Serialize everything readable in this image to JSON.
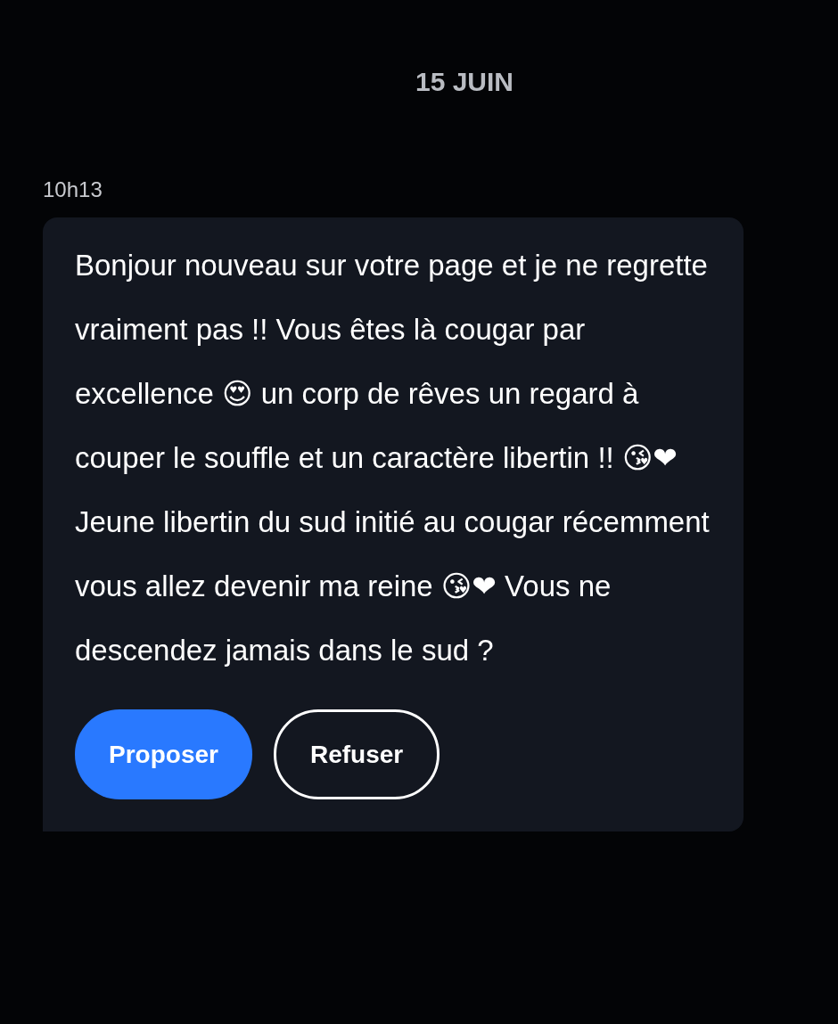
{
  "date_header": "15 JUIN",
  "message": {
    "time": "10h13",
    "text": "Bonjour nouveau sur votre page et je ne regrette vraiment pas !! Vous êtes là cougar par excellence 😍 un corp de rêves un regard à couper le souffle et un caractère libertin !! 😘❤ Jeune libertin du sud initié au cougar récemment vous allez devenir ma reine 😘❤ Vous ne descendez jamais dans le sud ?",
    "actions": [
      {
        "label": "Proposer",
        "kind": "primary"
      },
      {
        "label": "Refuser",
        "kind": "outline"
      }
    ]
  }
}
